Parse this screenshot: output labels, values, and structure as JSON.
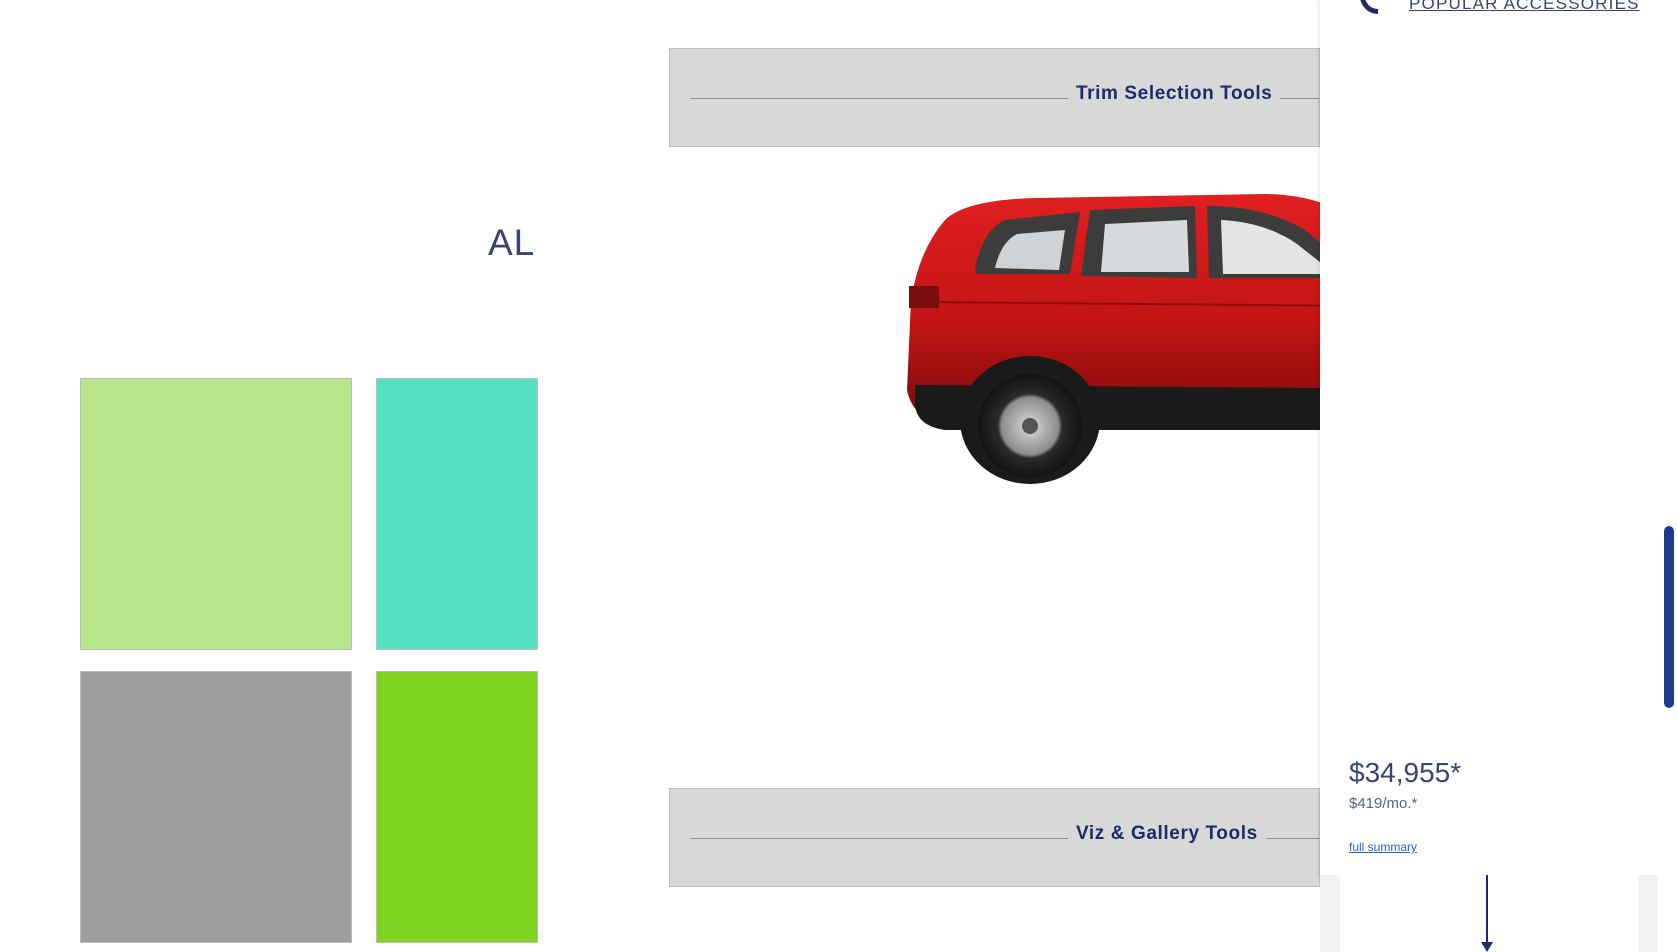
{
  "left_panel": {
    "heading": "AL",
    "swatches": [
      {
        "name": "swatch-light-green",
        "color": "#b8e68a"
      },
      {
        "name": "swatch-turquoise",
        "color": "#53e0c0"
      },
      {
        "name": "swatch-gray",
        "color": "#9e9e9e"
      },
      {
        "name": "swatch-lime-green",
        "color": "#7ed321"
      }
    ]
  },
  "center": {
    "trim_tools_label": "Trim Selection Tools",
    "viz_tools_label": "Viz & Gallery Tools",
    "vehicle_color": "#c41414"
  },
  "side_panel": {
    "accessories_link": "POPULAR ACCESSORIES",
    "price": "$34,955*",
    "monthly": "$419/mo.*",
    "summary_link": "full summary"
  },
  "colors": {
    "accent": "#1f2a6b",
    "band_bg": "#d8d8d8",
    "link": "#2a62c9"
  }
}
